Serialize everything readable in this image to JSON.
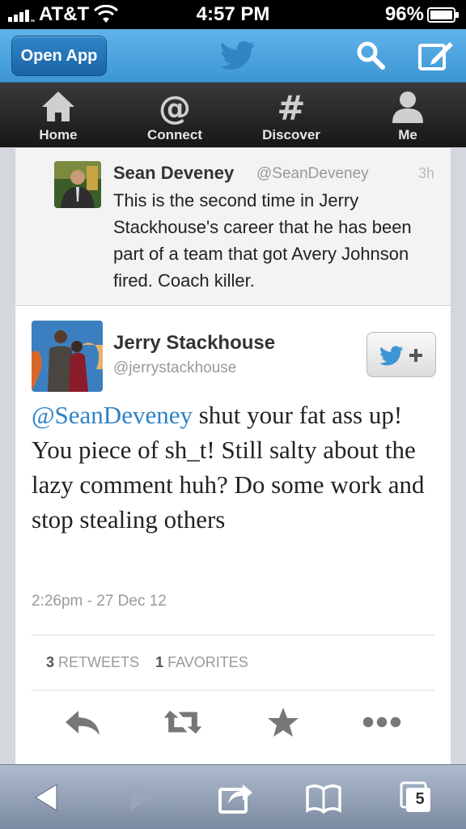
{
  "status": {
    "carrier": "AT&T",
    "time": "4:57 PM",
    "battery": "96%"
  },
  "appbar": {
    "open_app": "Open App"
  },
  "nav": [
    {
      "label": "Home"
    },
    {
      "label": "Connect"
    },
    {
      "label": "Discover"
    },
    {
      "label": "Me"
    }
  ],
  "prev_tweet": {
    "name": "Sean Deveney",
    "handle": "@SeanDeveney",
    "time": "3h",
    "text": "This is the second time in Jerry Stackhouse's career that he has been part of a team that got Avery Johnson fired. Coach killer."
  },
  "main_tweet": {
    "name": "Jerry Stackhouse",
    "handle": "@jerrystackhouse",
    "mention": "@SeanDeveney",
    "text": " shut your fat ass up! You piece of sh_t! Still salty about the lazy comment huh? Do some work and stop stealing others",
    "date": "2:26pm - 27 Dec 12",
    "retweets_count": "3",
    "retweets_label": "RETWEETS",
    "favorites_count": "1",
    "favorites_label": "FAVORITES"
  },
  "bottombar": {
    "tabs_count": "5"
  },
  "colors": {
    "twitter_blue": "#3d96d3",
    "link": "#2d82c6"
  }
}
